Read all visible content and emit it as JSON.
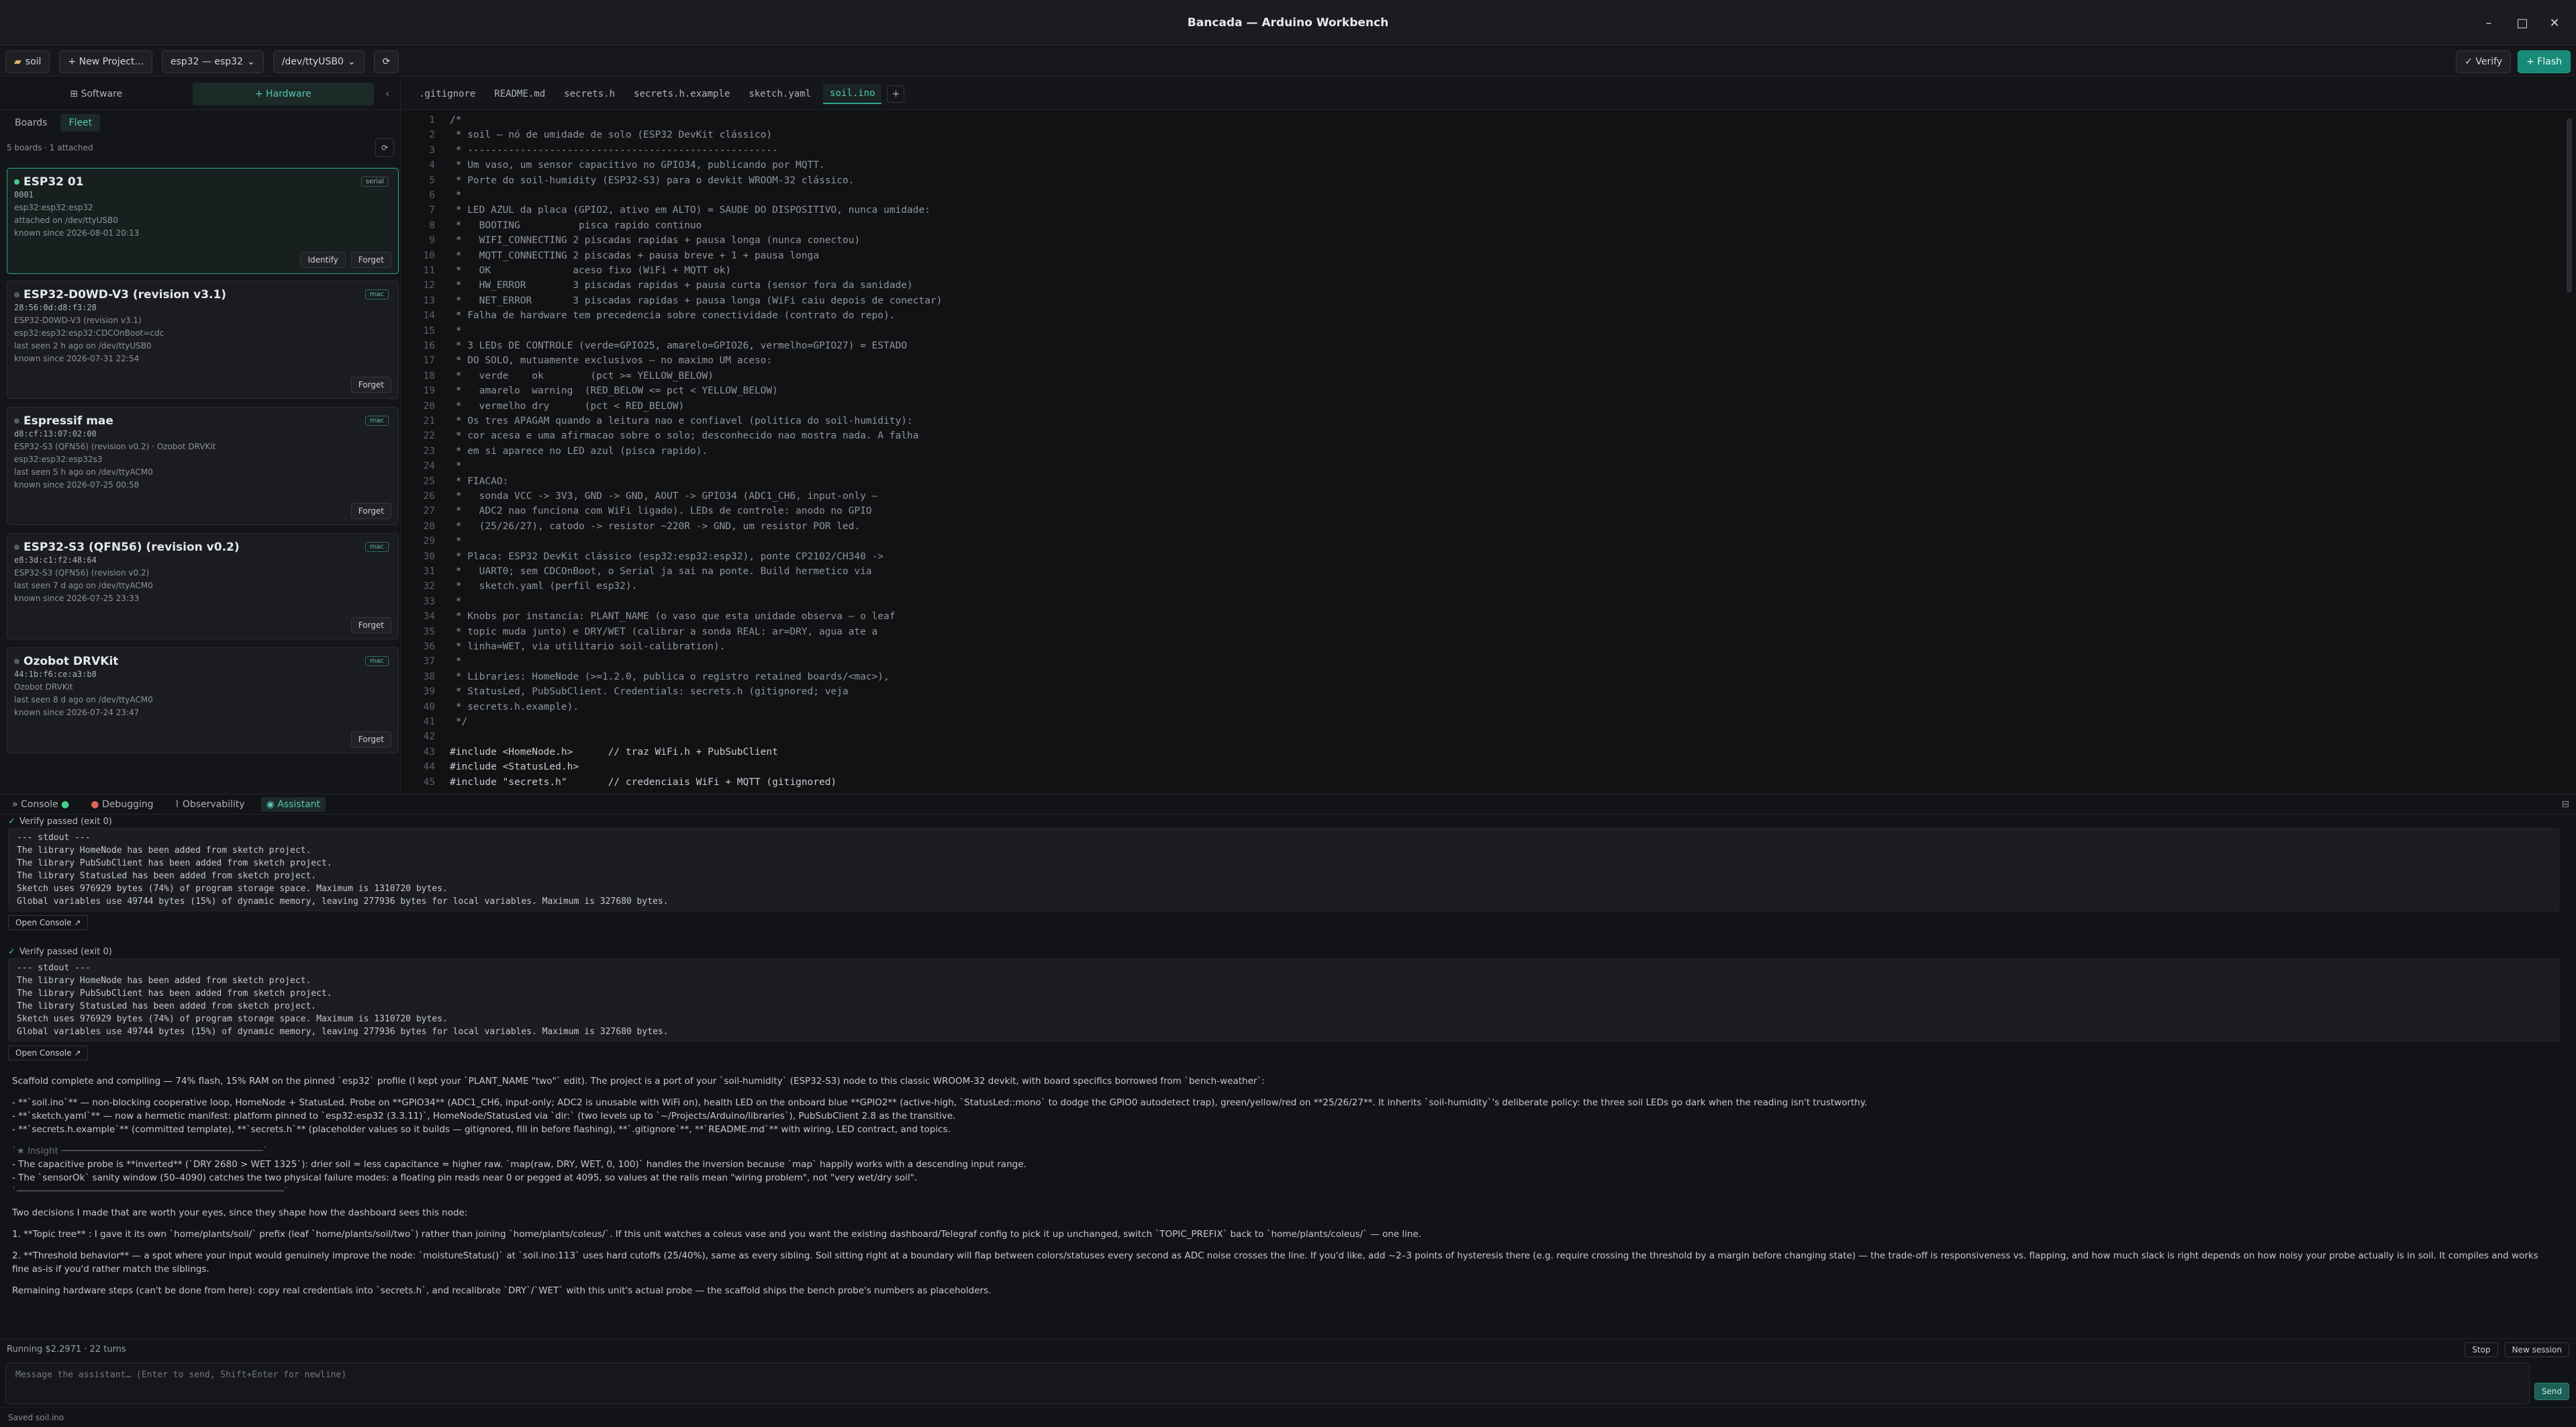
{
  "window": {
    "title": "Bancada — Arduino Workbench",
    "min": "–",
    "max": "□",
    "close": "✕"
  },
  "toolbar": {
    "project": "soil",
    "new_project": "+ New Project...",
    "board": "esp32 — esp32",
    "port": "/dev/ttyUSB0",
    "refresh": "⟳",
    "verify": "✓ Verify",
    "flash": "+ Flash"
  },
  "left": {
    "mode_software": "⊞ Software",
    "mode_hardware": "+ Hardware",
    "collapse": "‹",
    "tab_boards": "Boards",
    "tab_fleet": "Fleet",
    "count": "5 boards · 1 attached",
    "refresh": "⟳",
    "cards": [
      {
        "name": "ESP32 01",
        "badge": "serial",
        "id": "0001",
        "fqbn": "esp32:esp32:esp32",
        "seen": "attached on /dev/ttyUSB0",
        "known": "known since 2026-08-01 20:13",
        "identify": "Identify",
        "forget": "Forget"
      },
      {
        "name": "ESP32-D0WD-V3 (revision v3.1)",
        "badge": "mac",
        "id": "28:56:0d:d8:f3:28",
        "chip": "ESP32-D0WD-V3 (revision v3.1)",
        "fqbn": "esp32:esp32:esp32:CDCOnBoot=cdc",
        "seen": "last seen 2 h ago on /dev/ttyUSB0",
        "known": "known since 2026-07-31 22:54",
        "forget": "Forget"
      },
      {
        "name": "Espressif mae",
        "badge": "mac",
        "id": "d8:cf:13:07:02:00",
        "chip": "ESP32-S3 (QFN56) (revision v0.2) · Ozobot DRVKit",
        "fqbn": "esp32:esp32:esp32s3",
        "seen": "last seen 5 h ago on /dev/ttyACM0",
        "known": "known since 2026-07-25 00:58",
        "forget": "Forget"
      },
      {
        "name": "ESP32-S3 (QFN56) (revision v0.2)",
        "badge": "mac",
        "id": "e8:3d:c1:f2:48:64",
        "chip": "ESP32-S3 (QFN56) (revision v0.2)",
        "seen": "last seen 7 d ago on /dev/ttyACM0",
        "known": "known since 2026-07-25 23:33",
        "forget": "Forget"
      },
      {
        "name": "Ozobot DRVKit",
        "badge": "mac",
        "id": "44:1b:f6:ce:a3:b8",
        "chip": "Ozobot DRVKit",
        "seen": "last seen 8 d ago on /dev/ttyACM0",
        "known": "known since 2026-07-24 23:47",
        "forget": "Forget"
      }
    ]
  },
  "editor": {
    "tabs": [
      ".gitignore",
      "README.md",
      "secrets.h",
      "secrets.h.example",
      "sketch.yaml",
      "soil.ino"
    ],
    "active_tab": "soil.ino",
    "add_tab": "+",
    "lines": [
      "/*",
      " * soil — nó de umidade de solo (ESP32 DevKit clássico)",
      " * -----------------------------------------------------",
      " * Um vaso, um sensor capacitivo no GPIO34, publicando por MQTT.",
      " * Porte do soil-humidity (ESP32-S3) para o devkit WROOM-32 clássico.",
      " *",
      " * LED AZUL da placa (GPIO2, ativo em ALTO) = SAUDE DO DISPOSITIVO, nunca umidade:",
      " *   BOOTING          pisca rapido continuo",
      " *   WIFI_CONNECTING 2 piscadas rapidas + pausa longa (nunca conectou)",
      " *   MQTT_CONNECTING 2 piscadas + pausa breve + 1 + pausa longa",
      " *   OK              aceso fixo (WiFi + MQTT ok)",
      " *   HW_ERROR        3 piscadas rapidas + pausa curta (sensor fora da sanidade)",
      " *   NET_ERROR       3 piscadas rapidas + pausa longa (WiFi caiu depois de conectar)",
      " * Falha de hardware tem precedencia sobre conectividade (contrato do repo).",
      " *",
      " * 3 LEDs DE CONTROLE (verde=GPIO25, amarelo=GPIO26, vermelho=GPIO27) = ESTADO",
      " * DO SOLO, mutuamente exclusivos — no maximo UM aceso:",
      " *   verde    ok        (pct >= YELLOW_BELOW)",
      " *   amarelo  warning  (RED_BELOW <= pct < YELLOW_BELOW)",
      " *   vermelho dry      (pct < RED_BELOW)",
      " * Os tres APAGAM quando a leitura nao e confiavel (politica do soil-humidity):",
      " * cor acesa e uma afirmacao sobre o solo; desconhecido nao mostra nada. A falha",
      " * em si aparece no LED azul (pisca rapido).",
      " *",
      " * FIACAO:",
      " *   sonda VCC -> 3V3, GND -> GND, AOUT -> GPIO34 (ADC1_CH6, input-only —",
      " *   ADC2 nao funciona com WiFi ligado). LEDs de controle: anodo no GPIO",
      " *   (25/26/27), catodo -> resistor ~220R -> GND, um resistor POR led.",
      " *",
      " * Placa: ESP32 DevKit clássico (esp32:esp32:esp32), ponte CP2102/CH340 ->",
      " *   UART0; sem CDCOnBoot, o Serial ja sai na ponte. Build hermetico via",
      " *   sketch.yaml (perfil esp32).",
      " *",
      " * Knobs por instancia: PLANT_NAME (o vaso que esta unidade observa — o leaf",
      " * topic muda junto) e DRY/WET (calibrar a sonda REAL: ar=DRY, agua ate a",
      " * linha=WET, via utilitario soil-calibration).",
      " *",
      " * Libraries: HomeNode (>=1.2.0, publica o registro retained boards/<mac>),",
      " * StatusLed, PubSubClient. Credentials: secrets.h (gitignored; veja",
      " * secrets.h.example).",
      " */",
      "",
      "#include <HomeNode.h>      // traz WiFi.h + PubSubClient",
      "#include <StatusLed.h>",
      "#include \"secrets.h\"       // credenciais WiFi + MQTT (gitignored)"
    ]
  },
  "bottom": {
    "tabs": [
      "» Console",
      "Debugging",
      "Observability",
      "Assistant"
    ],
    "active_tab": "Assistant",
    "panel_toggle": "⊟",
    "runs": [
      {
        "head": "Verify passed (exit 0)",
        "stdout": "--- stdout ---\nThe library HomeNode has been added from sketch project.\nThe library PubSubClient has been added from sketch project.\nThe library StatusLed has been added from sketch project.\nSketch uses 976929 bytes (74%) of program storage space. Maximum is 1310720 bytes.\nGlobal variables use 49744 bytes (15%) of dynamic memory, leaving 277936 bytes for local variables. Maximum is 327680 bytes.",
        "open": "Open Console ↗"
      },
      {
        "head": "Verify passed (exit 0)",
        "stdout": "--- stdout ---\nThe library HomeNode has been added from sketch project.\nThe library PubSubClient has been added from sketch project.\nThe library StatusLed has been added from sketch project.\nSketch uses 976929 bytes (74%) of program storage space. Maximum is 1310720 bytes.\nGlobal variables use 49744 bytes (15%) of dynamic memory, leaving 277936 bytes for local variables. Maximum is 327680 bytes.",
        "open": "Open Console ↗"
      }
    ],
    "assistant": {
      "p1": "Scaffold complete and compiling — 74% flash, 15% RAM on the pinned `esp32` profile (I kept your `PLANT_NAME \"two\"` edit). The project is a port of your `soil-humidity` (ESP32-S3) node to this classic WROOM-32 devkit, with board specifics borrowed from `bench-weather`:",
      "b1": "- **`soil.ino`** — non-blocking cooperative loop, HomeNode + StatusLed. Probe on **GPIO34** (ADC1_CH6, input-only; ADC2 is unusable with WiFi on), health LED on the onboard blue **GPIO2** (active-high, `StatusLed::mono` to dodge the GPIO0 autodetect trap), green/yellow/red on **25/26/27**. It inherits `soil-humidity`'s deliberate policy: the three soil LEDs go dark when the reading isn't trustworthy.",
      "b2": "- **`sketch.yaml`** — now a hermetic manifest: platform pinned to `esp32:esp32 (3.3.11)`, HomeNode/StatusLed via `dir:` (two levels up to `~/Projects/Arduino/libraries`), PubSubClient 2.8 as the transitive.",
      "b3": "- **`secrets.h.example`** (committed template), **`secrets.h`** (placeholder values so it builds — gitignored, fill in before flashing), **`.gitignore`**, **`README.md`** with wiring, LED contract, and topics.",
      "insight_head": "`★ Insight ─────────────────────────────────────`",
      "i1": "- The capacitive probe is **inverted** (`DRY 2680 > WET 1325`): drier soil = less capacitance = higher raw. `map(raw, DRY, WET, 0, 100)` handles the inversion because `map` happily works with a descending input range.",
      "i2": "- The `sensorOk` sanity window (50–4090) catches the two physical failure modes: a floating pin reads near 0 or pegged at 4095, so values at the rails mean \"wiring problem\", not \"very wet/dry soil\".",
      "insight_foot": "`─────────────────────────────────────────────────`",
      "p2": "Two decisions I made that are worth your eyes, since they shape how the dashboard sees this node:",
      "d1": "1. **Topic tree** : I gave it its own `home/plants/soil/` prefix (leaf `home/plants/soil/two`) rather than joining `home/plants/coleus/`. If this unit watches a coleus vase and you want the existing dashboard/Telegraf config to pick it up unchanged, switch `TOPIC_PREFIX` back to `home/plants/coleus/` — one line.",
      "d2": "2. **Threshold behavior** — a spot where your input would genuinely improve the node: `moistureStatus()` at `soil.ino:113` uses hard cutoffs (25/40%), same as every sibling. Soil sitting right at a boundary will flap between colors/statuses every second as ADC noise crosses the line. If you'd like, add ~2–3 points of hysteresis there (e.g. require crossing the threshold by a margin before changing state) — the trade-off is responsiveness vs. flapping, and how much slack is right depends on how noisy your probe actually is in soil. It compiles and works fine as-is if you'd rather match the siblings.",
      "p3": "Remaining hardware steps (can't be done from here): copy real credentials into `secrets.h`, and recalibrate `DRY`/`WET` with this unit's actual probe — the scaffold ships the bench probe's numbers as placeholders."
    },
    "status": {
      "running": "Running $2.2971 · 22 turns",
      "stop": "Stop",
      "new_session": "New session"
    },
    "compose": {
      "placeholder": "Message the assistant… (Enter to send, Shift+Enter for newline)",
      "send": "Send"
    },
    "saved": "Saved soil.ino"
  }
}
